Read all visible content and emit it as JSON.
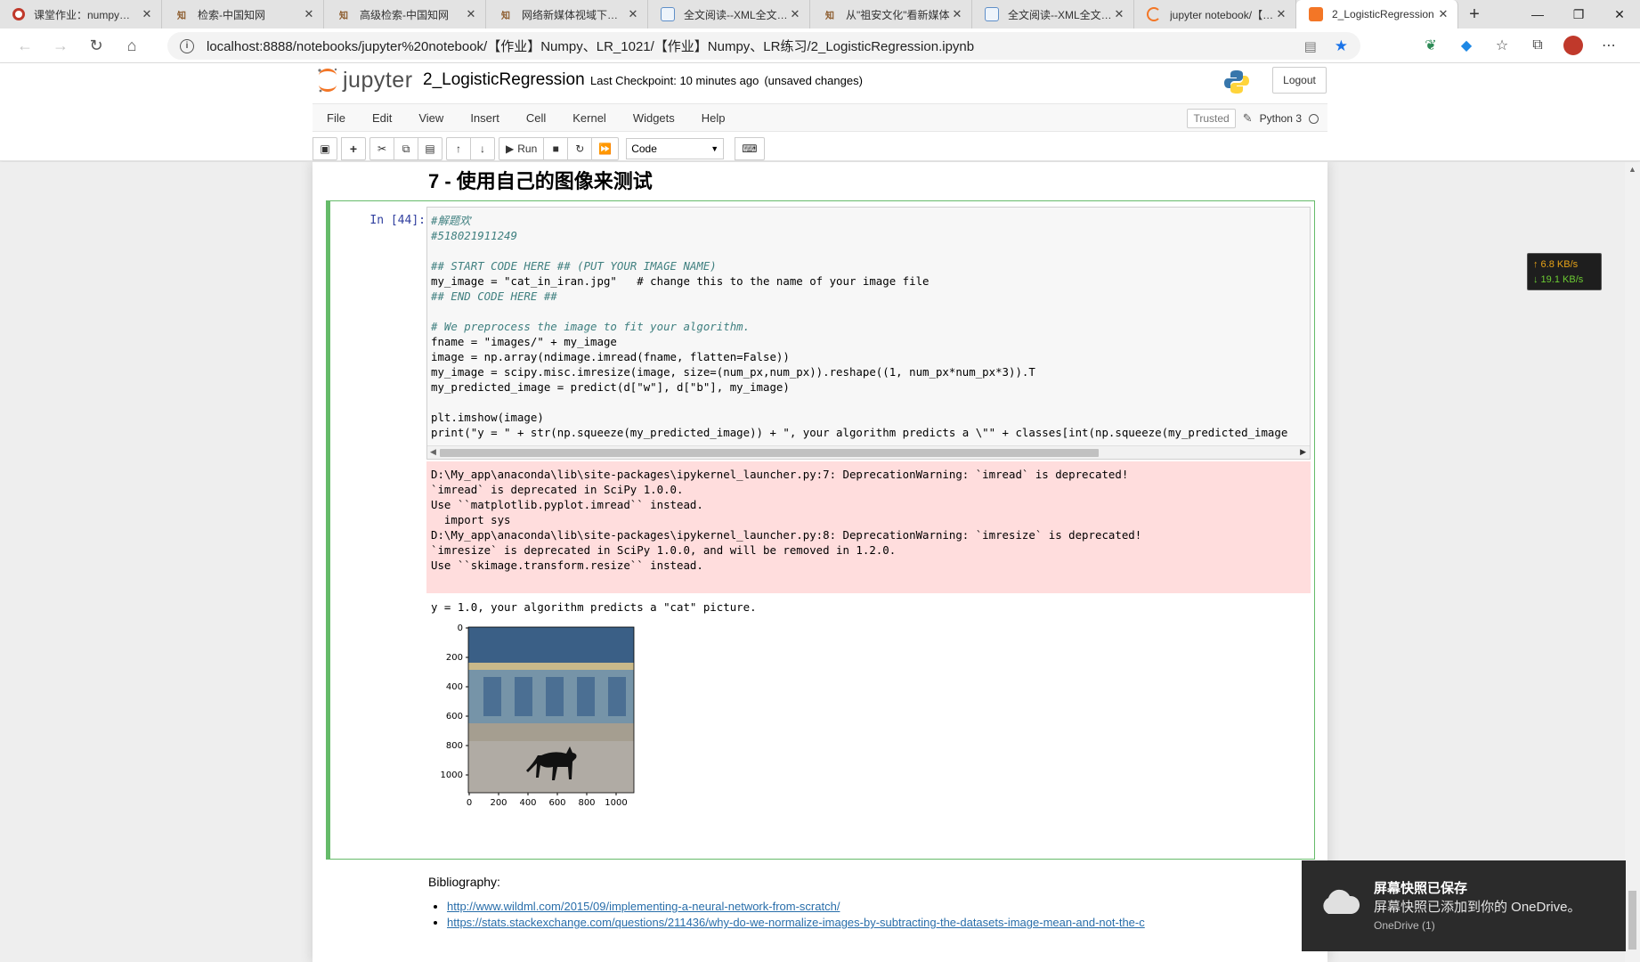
{
  "browser": {
    "tabs": [
      {
        "title": "课堂作业：numpy基础",
        "icon": "red-circle-icon",
        "color": "#c0392b"
      },
      {
        "title": "检索-中国知网",
        "icon": "cnki-icon",
        "color": "#8b5a2b"
      },
      {
        "title": "高级检索-中国知网",
        "icon": "cnki-icon",
        "color": "#8b5a2b"
      },
      {
        "title": "网络新媒体视域下高校",
        "icon": "cnki-icon",
        "color": "#8b5a2b"
      },
      {
        "title": "全文阅读--XML全文阅读",
        "icon": "document-icon",
        "color": "#5f8fc8"
      },
      {
        "title": "从\"祖安文化\"看新媒体",
        "icon": "cnki-icon",
        "color": "#8b5a2b"
      },
      {
        "title": "全文阅读--XML全文阅读",
        "icon": "document-icon",
        "color": "#5f8fc8"
      },
      {
        "title": "jupyter notebook/【作业】",
        "icon": "jupyter-icon",
        "color": "#f37626"
      },
      {
        "title": "2_LogisticRegression",
        "icon": "jupyter-icon",
        "color": "#f37626",
        "active": true
      }
    ],
    "new_tab": "+",
    "window": {
      "minimize": "—",
      "maximize": "❐",
      "close": "✕"
    },
    "url": "localhost:8888/notebooks/jupyter%20notebook/【作业】Numpy、LR_1021/【作业】Numpy、LR练习/2_LogisticRegression.ipynb"
  },
  "jupyter": {
    "logo_text": "jupyter",
    "notebook_name": "2_LogisticRegression",
    "checkpoint": "Last Checkpoint: 10 minutes ago",
    "unsaved": "(unsaved changes)",
    "logout": "Logout",
    "menu": [
      "File",
      "Edit",
      "View",
      "Insert",
      "Cell",
      "Kernel",
      "Widgets",
      "Help"
    ],
    "trusted": "Trusted",
    "kernel": "Python 3",
    "run_label": "Run",
    "cell_type": "Code"
  },
  "notebook": {
    "heading": "7 - 使用自己的图像来测试",
    "cell": {
      "prompt": "In [44]:",
      "code_lines": [
        "#解题欢",
        "#518021911249",
        "",
        "## START CODE HERE ## (PUT YOUR IMAGE NAME)",
        "my_image = \"cat_in_iran.jpg\"   # change this to the name of your image file",
        "## END CODE HERE ##",
        "",
        "# We preprocess the image to fit your algorithm.",
        "fname = \"images/\" + my_image",
        "image = np.array(ndimage.imread(fname, flatten=False))",
        "my_image = scipy.misc.imresize(image, size=(num_px,num_px)).reshape((1, num_px*num_px*3)).T",
        "my_predicted_image = predict(d[\"w\"], d[\"b\"], my_image)",
        "",
        "plt.imshow(image)",
        "print(\"y = \" + str(np.squeeze(my_predicted_image)) + \", your algorithm predicts a \\\"\" + classes[int(np.squeeze(my_predicted_image"
      ],
      "stderr": "D:\\My_app\\anaconda\\lib\\site-packages\\ipykernel_launcher.py:7: DeprecationWarning: `imread` is deprecated!\n`imread` is deprecated in SciPy 1.0.0.\nUse ``matplotlib.pyplot.imread`` instead.\n  import sys\nD:\\My_app\\anaconda\\lib\\site-packages\\ipykernel_launcher.py:8: DeprecationWarning: `imresize` is deprecated!\n`imresize` is deprecated in SciPy 1.0.0, and will be removed in 1.2.0.\nUse ``skimage.transform.resize`` instead.",
      "stdout": "y = 1.0, your algorithm predicts a \"cat\" picture."
    },
    "plot": {
      "y_ticks": [
        "0",
        "200",
        "400",
        "600",
        "800",
        "1000"
      ],
      "x_ticks": [
        "0",
        "200",
        "400",
        "600",
        "800",
        "1000"
      ],
      "image_desc": "cat-photo-image"
    },
    "bibliography": {
      "label": "Bibliography:",
      "links": [
        "http://www.wildml.com/2015/09/implementing-a-neural-network-from-scratch/",
        "https://stats.stackexchange.com/questions/211436/why-do-we-normalize-images-by-subtracting-the-datasets-image-mean-and-not-the-c"
      ]
    }
  },
  "netspeed": {
    "up": "↑ 6.8 KB/s",
    "down": "↓ 19.1 KB/s"
  },
  "toast": {
    "title": "屏幕快照已保存",
    "body": "屏幕快照已添加到你的 OneDrive。",
    "source": "OneDrive (1)"
  },
  "colors": {
    "accent": "#f37626",
    "selected_cell": "#66bb6a",
    "stderr_bg": "#ffdddd",
    "link": "#296eaa"
  }
}
